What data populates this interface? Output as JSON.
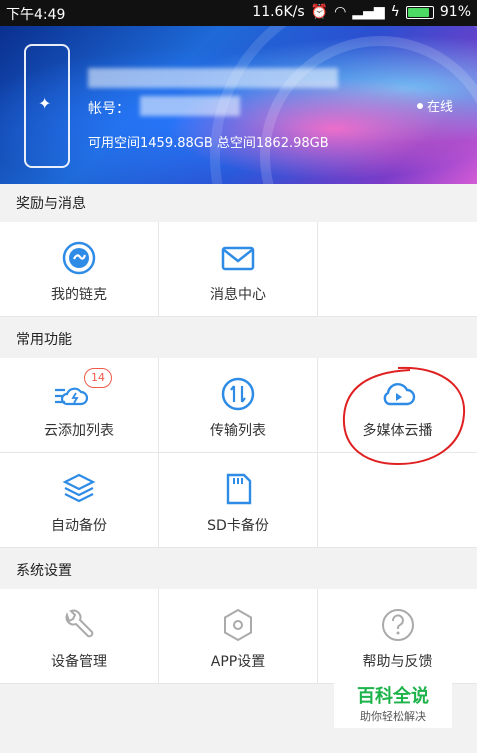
{
  "status_bar": {
    "time": "下午4:49",
    "network_speed": "11.6K/s",
    "battery": "91%"
  },
  "profile": {
    "account_label": "帐号：",
    "space_text": "可用空间1459.88GB 总空间1862.98GB",
    "online_status": "在线"
  },
  "sections": {
    "rewards": {
      "title": "奖励与消息",
      "items": [
        {
          "label": "我的链克",
          "icon": "link-coin-icon"
        },
        {
          "label": "消息中心",
          "icon": "mail-icon"
        }
      ]
    },
    "common": {
      "title": "常用功能",
      "items": [
        {
          "label": "云添加列表",
          "icon": "cloud-add-list-icon",
          "badge": "14"
        },
        {
          "label": "传输列表",
          "icon": "transfer-icon"
        },
        {
          "label": "多媒体云播",
          "icon": "cloud-play-icon"
        },
        {
          "label": "自动备份",
          "icon": "layers-backup-icon"
        },
        {
          "label": "SD卡备份",
          "icon": "sd-card-icon"
        }
      ]
    },
    "system": {
      "title": "系统设置",
      "items": [
        {
          "label": "设备管理",
          "icon": "wrench-icon"
        },
        {
          "label": "APP设置",
          "icon": "hexagon-settings-icon"
        },
        {
          "label": "帮助与反馈",
          "icon": "help-icon"
        }
      ]
    }
  },
  "watermark": {
    "title": "百科全说",
    "subtitle": "助你轻松解决"
  },
  "colors": {
    "accent_blue": "#2f8ce6",
    "badge_red": "#f05a4a",
    "annotation_red": "#e02020"
  }
}
